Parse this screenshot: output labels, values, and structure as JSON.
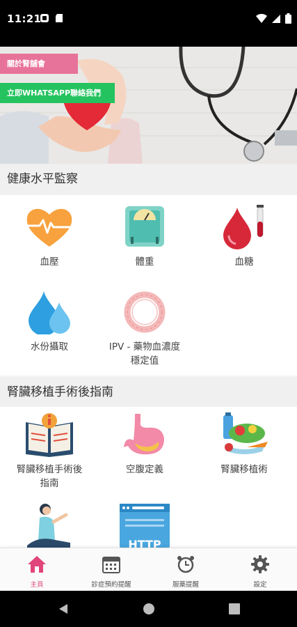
{
  "status_bar": {
    "time": "11:21"
  },
  "hero": {
    "about_button": "關於腎舖會",
    "whatsapp_button": "立即WHATSAPP聯絡我們"
  },
  "health_section": {
    "title": "健康水平監察",
    "items": [
      {
        "label": "血壓",
        "icon": "heart-pulse-icon"
      },
      {
        "label": "體重",
        "icon": "scale-icon"
      },
      {
        "label": "血糖",
        "icon": "blood-drop-tube-icon"
      },
      {
        "label": "水份攝取",
        "icon": "water-drops-icon"
      },
      {
        "label_line1": "IPV - 藥物血濃度",
        "label_line2": "穩定值",
        "icon": "ring-icon"
      }
    ]
  },
  "guide_section": {
    "title": "腎臟移植手術後指南",
    "items": [
      {
        "label_line1": "腎臟移植手術後",
        "label_line2": "指南",
        "icon": "info-book-icon"
      },
      {
        "label": "空腹定義",
        "icon": "stomach-icon"
      },
      {
        "label": "腎臟移植術",
        "icon": "healthy-food-icon"
      },
      {
        "label": "",
        "icon": "yoga-person-icon"
      },
      {
        "label": "",
        "icon": "http-icon"
      }
    ]
  },
  "bottom_nav": {
    "items": [
      {
        "label": "主頁",
        "icon": "home-icon",
        "active": true
      },
      {
        "label": "診症預約提醒",
        "icon": "calendar-icon",
        "active": false
      },
      {
        "label": "服藥提醒",
        "icon": "alarm-clock-icon",
        "active": false
      },
      {
        "label": "設定",
        "icon": "gear-icon",
        "active": false
      }
    ]
  },
  "colors": {
    "accent_pink": "#e8739a",
    "whatsapp_green": "#25c35f",
    "active_nav": "#e0457b"
  }
}
